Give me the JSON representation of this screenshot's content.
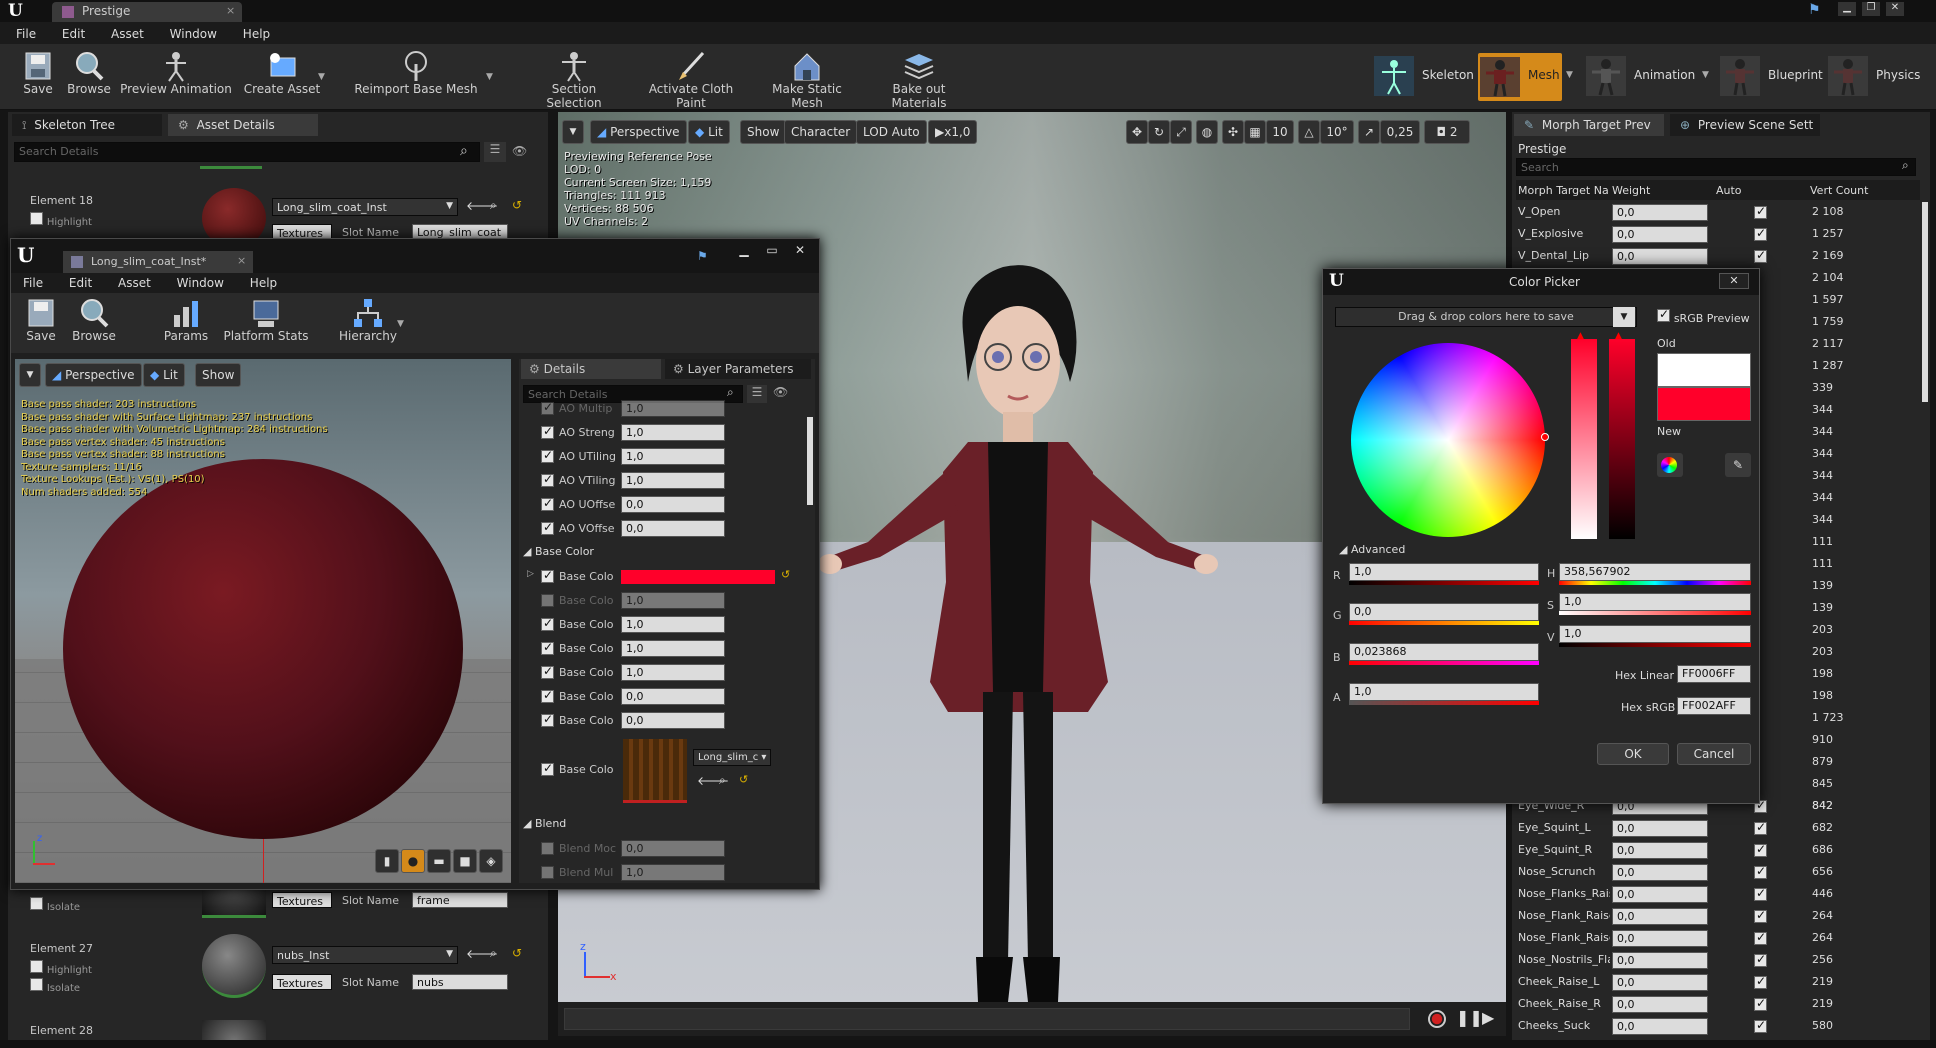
{
  "main_window": {
    "tab_title": "Prestige",
    "menu": [
      "File",
      "Edit",
      "Asset",
      "Window",
      "Help"
    ],
    "toolbar": [
      {
        "label": "Save",
        "icon": "save-icon"
      },
      {
        "label": "Browse",
        "icon": "browse-icon"
      },
      {
        "label": "Preview Animation",
        "icon": "preview-animation-icon"
      },
      {
        "label": "Create Asset",
        "icon": "create-asset-icon"
      },
      {
        "label": "Reimport Base Mesh",
        "icon": "reimport-icon"
      },
      {
        "label": "Section Selection",
        "icon": "section-selection-icon"
      },
      {
        "label": "Activate Cloth Paint",
        "icon": "cloth-paint-icon"
      },
      {
        "label": "Make Static Mesh",
        "icon": "static-mesh-icon"
      },
      {
        "label": "Bake out Materials",
        "icon": "bake-materials-icon"
      }
    ],
    "modes": [
      {
        "label": "Skeleton",
        "active": false
      },
      {
        "label": "Mesh",
        "active": true
      },
      {
        "label": "Animation",
        "active": false
      },
      {
        "label": "Blueprint",
        "active": false
      },
      {
        "label": "Physics",
        "active": false
      }
    ]
  },
  "left_panel": {
    "tabs": [
      "Skeleton Tree",
      "Asset Details"
    ],
    "search_placeholder": "Search Details",
    "element18": {
      "label": "Element 18",
      "highlight": "Highlight",
      "material": "Long_slim_coat_Inst",
      "textures": "Textures",
      "slot_label": "Slot Name",
      "slot_value": "Long_slim_coat"
    },
    "isolate": "Isolate",
    "frame_textures": "Textures",
    "frame_slot_label": "Slot Name",
    "frame_slot_value": "frame",
    "element27": {
      "label": "Element 27",
      "highlight": "Highlight",
      "isolate": "Isolate",
      "material": "nubs_Inst",
      "textures": "Textures",
      "slot_label": "Slot Name",
      "slot_value": "nubs"
    },
    "element28": {
      "label": "Element 28"
    }
  },
  "viewport": {
    "buttons": [
      "Perspective",
      "Lit",
      "Show",
      "Character",
      "LOD Auto",
      "x1,0"
    ],
    "right_values": [
      "10",
      "10°",
      "0,25",
      "2"
    ],
    "info": [
      "Previewing Reference Pose",
      "LOD: 0",
      "Current Screen Size: 1,159",
      "Triangles: 111 913",
      "Vertices: 88 506",
      "UV Channels: 2"
    ]
  },
  "material_window": {
    "tab_title": "Long_slim_coat_Inst*",
    "menu": [
      "File",
      "Edit",
      "Asset",
      "Window",
      "Help"
    ],
    "toolbar": [
      {
        "label": "Save"
      },
      {
        "label": "Browse"
      },
      {
        "label": "Params"
      },
      {
        "label": "Platform Stats"
      },
      {
        "label": "Hierarchy"
      }
    ],
    "vp_buttons": [
      "Perspective",
      "Lit",
      "Show"
    ],
    "stats": [
      "Base pass shader: 203 instructions",
      "Base pass shader with Surface Lightmap: 237 instructions",
      "Base pass shader with Volumetric Lightmap: 284 instructions",
      "Base pass vertex shader: 45 instructions",
      "Base pass vertex shader: 88 instructions",
      "Texture samplers: 11/16",
      "Texture Lookups (Est.): VS(1), PS(10)",
      "Num shaders added: 554"
    ],
    "details_tabs": [
      "Details",
      "Layer Parameters"
    ],
    "search_placeholder": "Search Details",
    "params": [
      {
        "name": "AO Multip",
        "value": "1,0",
        "checked": true,
        "enabled": false
      },
      {
        "name": "AO Streng",
        "value": "1,0",
        "checked": true,
        "enabled": true
      },
      {
        "name": "AO UTiling",
        "value": "1,0",
        "checked": true,
        "enabled": true
      },
      {
        "name": "AO VTiling",
        "value": "1,0",
        "checked": true,
        "enabled": true
      },
      {
        "name": "AO UOffse",
        "value": "0,0",
        "checked": true,
        "enabled": true
      },
      {
        "name": "AO VOffse",
        "value": "0,0",
        "checked": true,
        "enabled": true
      }
    ],
    "base_color_section": "Base Color",
    "base_params": [
      {
        "name": "Base Colo",
        "value": "",
        "checked": true,
        "enabled": true,
        "swatch": true
      },
      {
        "name": "Base Colo",
        "value": "1,0",
        "checked": false,
        "enabled": false
      },
      {
        "name": "Base Colo",
        "value": "1,0",
        "checked": true,
        "enabled": true
      },
      {
        "name": "Base Colo",
        "value": "1,0",
        "checked": true,
        "enabled": true
      },
      {
        "name": "Base Colo",
        "value": "1,0",
        "checked": true,
        "enabled": true
      },
      {
        "name": "Base Colo",
        "value": "0,0",
        "checked": true,
        "enabled": true
      },
      {
        "name": "Base Colo",
        "value": "0,0",
        "checked": true,
        "enabled": true
      }
    ],
    "texture_param": {
      "name": "Base Colo",
      "texture": "Long_slim_c"
    },
    "blend_section": "Blend",
    "blend_params": [
      {
        "name": "Blend Moc",
        "value": "0,0"
      },
      {
        "name": "Blend Mul",
        "value": "1,0"
      }
    ]
  },
  "morph_panel": {
    "tabs": [
      "Morph Target Prev",
      "Preview Scene Sett"
    ],
    "asset_name": "Prestige",
    "search_placeholder": "Search",
    "headers": [
      "Morph Target Na",
      "Weight",
      "Auto",
      "Vert Count"
    ],
    "rows_top": [
      {
        "name": "V_Open",
        "weight": "0,0",
        "count": "2 108"
      },
      {
        "name": "V_Explosive",
        "weight": "0,0",
        "count": "1 257"
      },
      {
        "name": "V_Dental_Lip",
        "weight": "0,0",
        "count": "2 169"
      }
    ],
    "hidden_counts": [
      "2 104",
      "1 597",
      "1 759",
      "2 117",
      "1 287",
      "339",
      "344",
      "344",
      "344",
      "344",
      "344",
      "344",
      "111",
      "111",
      "139",
      "139",
      "203",
      "203",
      "198",
      "198",
      "1 723",
      "910",
      "879",
      "845",
      "842"
    ],
    "rows_bottom": [
      {
        "name": "Eye_Wide_R",
        "weight": "0,0",
        "count": "842"
      },
      {
        "name": "Eye_Squint_L",
        "weight": "0,0",
        "count": "682"
      },
      {
        "name": "Eye_Squint_R",
        "weight": "0,0",
        "count": "686"
      },
      {
        "name": "Nose_Scrunch",
        "weight": "0,0",
        "count": "656"
      },
      {
        "name": "Nose_Flanks_Rais",
        "weight": "0,0",
        "count": "446"
      },
      {
        "name": "Nose_Flank_Raise",
        "weight": "0,0",
        "count": "264"
      },
      {
        "name": "Nose_Flank_Raise",
        "weight": "0,0",
        "count": "264"
      },
      {
        "name": "Nose_Nostrils_Fla",
        "weight": "0,0",
        "count": "256"
      },
      {
        "name": "Cheek_Raise_L",
        "weight": "0,0",
        "count": "219"
      },
      {
        "name": "Cheek_Raise_R",
        "weight": "0,0",
        "count": "219"
      },
      {
        "name": "Cheeks_Suck",
        "weight": "0,0",
        "count": "580"
      }
    ]
  },
  "color_picker": {
    "title": "Color Picker",
    "dropdown": "Drag & drop colors here to save",
    "srgb": "sRGB Preview",
    "old_label": "Old",
    "new_label": "New",
    "advanced": "Advanced",
    "r_label": "R",
    "r_value": "1,0",
    "g_label": "G",
    "g_value": "0,0",
    "b_label": "B",
    "b_value": "0,023868",
    "a_label": "A",
    "a_value": "1,0",
    "h_label": "H",
    "h_value": "358,567902",
    "s_label": "S",
    "s_value": "1,0",
    "v_label": "V",
    "v_value": "1,0",
    "hex_linear_label": "Hex Linear",
    "hex_linear": "FF0006FF",
    "hex_srgb_label": "Hex sRGB",
    "hex_srgb": "FF002AFF",
    "ok": "OK",
    "cancel": "Cancel",
    "old_color": "#ffffff",
    "new_color": "#ff002a"
  }
}
